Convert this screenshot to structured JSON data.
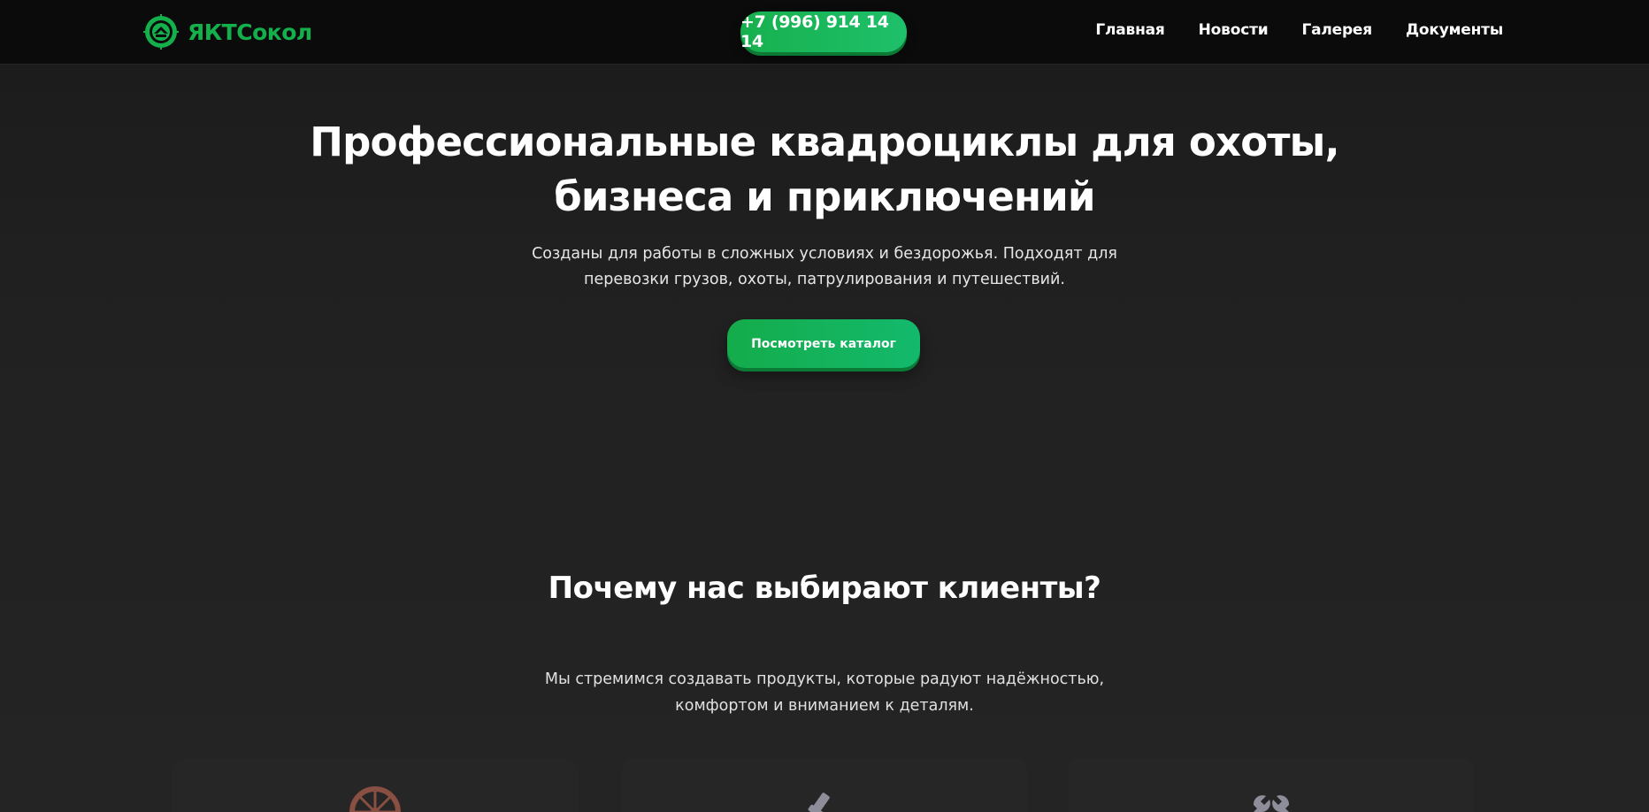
{
  "header": {
    "logo_text": "ЯКТСокол",
    "phone": "+7 (996) 914 14 14",
    "nav": [
      "Главная",
      "Новости",
      "Галерея",
      "Документы"
    ]
  },
  "hero": {
    "title": "Профессиональные квадроциклы для охоты, бизнеса и приключений",
    "subtitle": "Созданы для работы в сложных условиях и бездорожья. Подходят для перевозки грузов, охоты, патрулирования и путешествий.",
    "cta_label": "Посмотреть каталог"
  },
  "why": {
    "title": "Почему нас выбирают клиенты?",
    "subtitle": "Мы стремимся создавать продукты, которые радуют надёжностью, комфортом и вниманием к деталям.",
    "cards": [
      {
        "icon": "wheel-icon"
      },
      {
        "icon": "tools-icon"
      },
      {
        "icon": "wrench-icon"
      }
    ]
  },
  "colors": {
    "brand_green": "#13b04b",
    "background": "#212121",
    "header_bg": "#0b0b0b"
  }
}
